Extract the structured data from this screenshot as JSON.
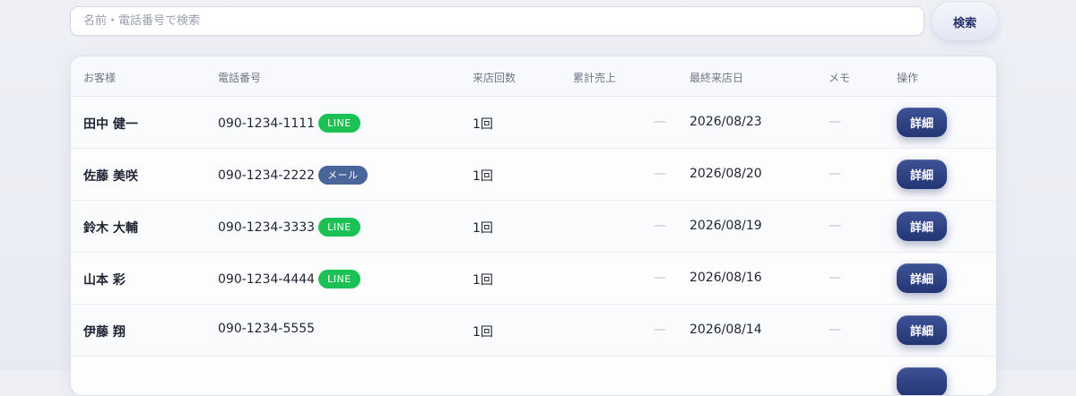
{
  "search": {
    "placeholder": "名前・電話番号で検索",
    "button_label": "検索"
  },
  "table": {
    "headers": [
      "お客様",
      "電話番号",
      "来店回数",
      "累計売上",
      "最終来店日",
      "メモ",
      "操作"
    ],
    "rows": [
      {
        "name": "田中 健一",
        "phone": "090-1234-1111",
        "badge": "LINE",
        "badge_type": "line",
        "visits": "1回",
        "sales": "—",
        "last_visit": "2026/08/23",
        "memo": "—",
        "action": "詳細"
      },
      {
        "name": "佐藤 美咲",
        "phone": "090-1234-2222",
        "badge": "メール",
        "badge_type": "mail",
        "visits": "1回",
        "sales": "—",
        "last_visit": "2026/08/20",
        "memo": "—",
        "action": "詳細"
      },
      {
        "name": "鈴木 大輔",
        "phone": "090-1234-3333",
        "badge": "LINE",
        "badge_type": "line",
        "visits": "1回",
        "sales": "—",
        "last_visit": "2026/08/19",
        "memo": "—",
        "action": "詳細"
      },
      {
        "name": "山本 彩",
        "phone": "090-1234-4444",
        "badge": "LINE",
        "badge_type": "line",
        "visits": "1回",
        "sales": "—",
        "last_visit": "2026/08/16",
        "memo": "—",
        "action": "詳細"
      },
      {
        "name": "伊藤 翔",
        "phone": "090-1234-5555",
        "badge": "",
        "badge_type": "",
        "visits": "1回",
        "sales": "—",
        "last_visit": "2026/08/14",
        "memo": "—",
        "action": "詳細"
      }
    ]
  },
  "colors": {
    "line_badge": "#1bc155",
    "mail_badge": "#4a6599",
    "primary_button": "#2b3d80"
  }
}
